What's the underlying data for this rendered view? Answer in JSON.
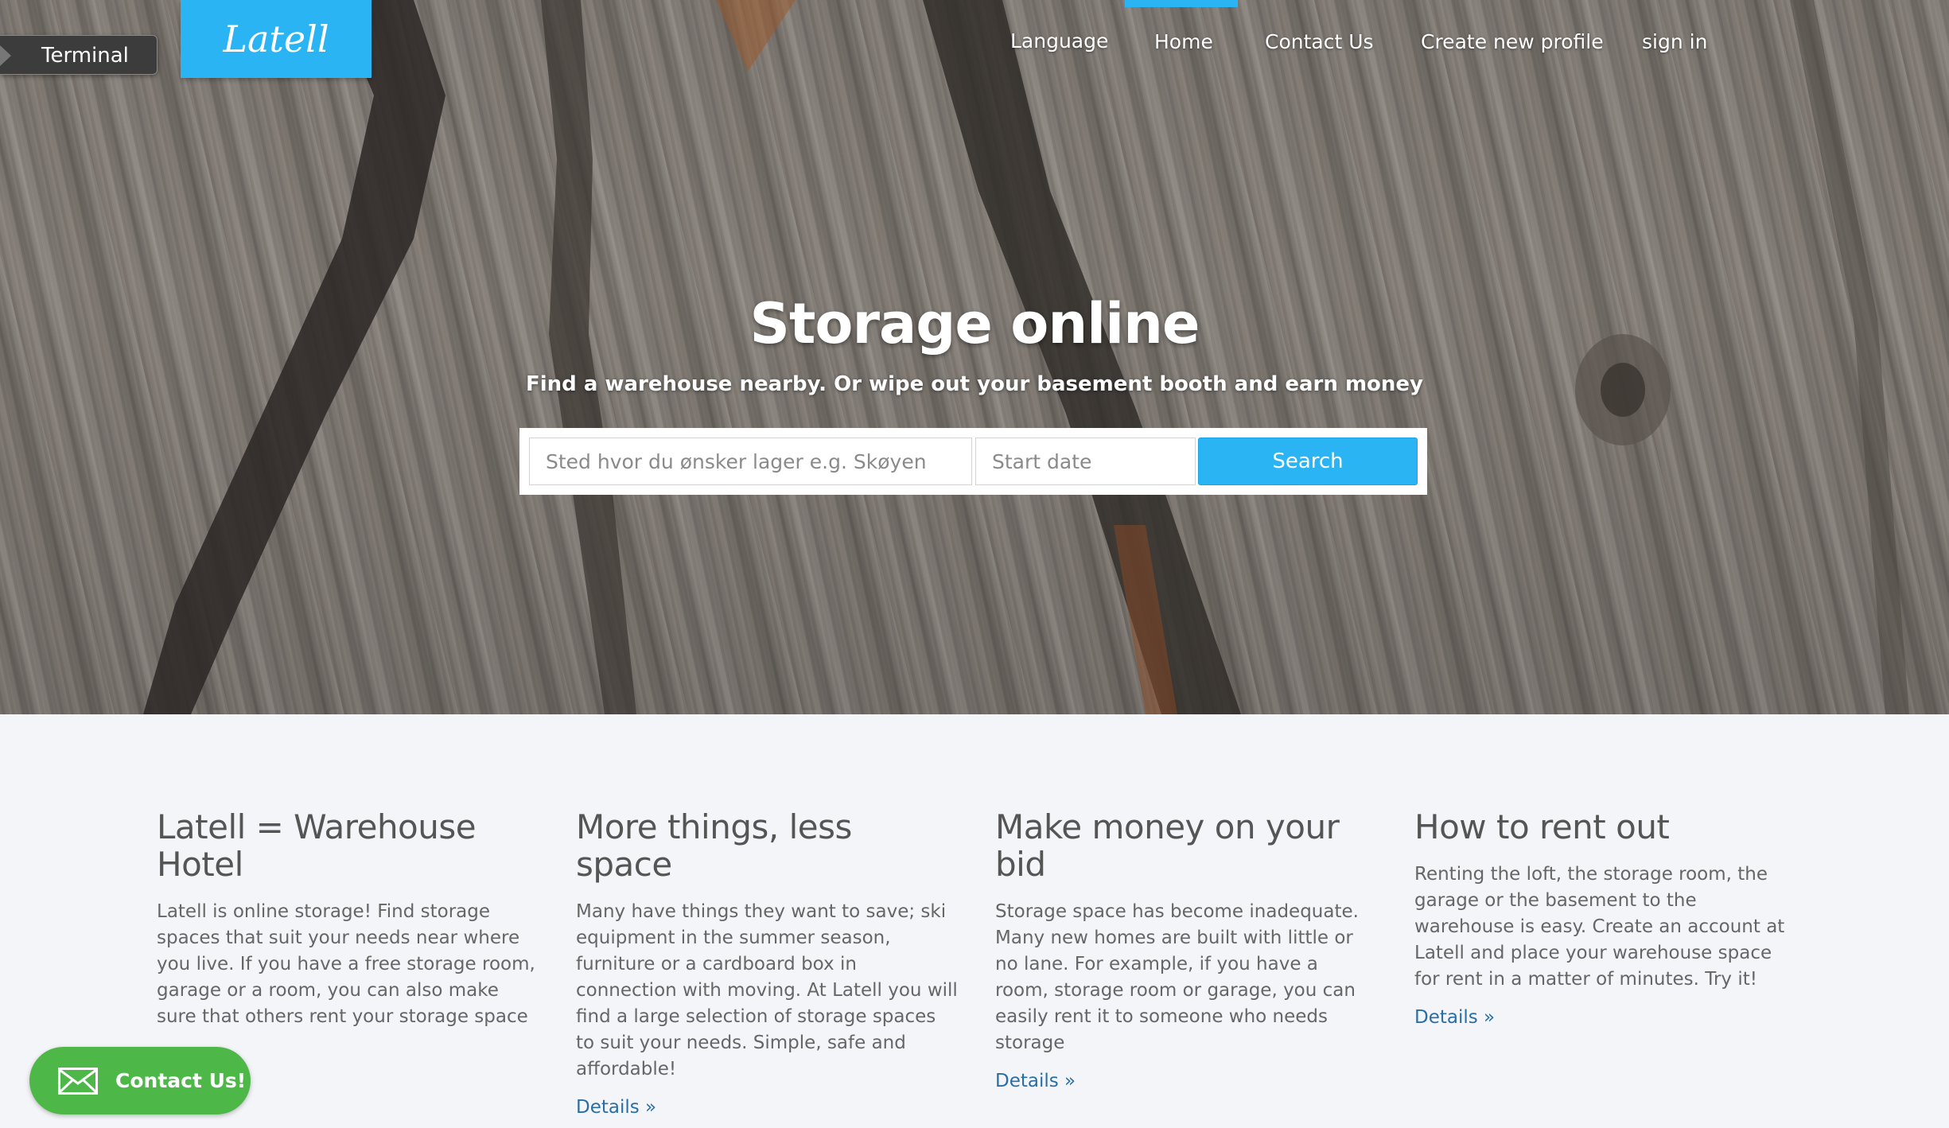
{
  "terminal": {
    "label": "Terminal"
  },
  "logo": {
    "text": "Latell"
  },
  "nav": {
    "items": [
      {
        "label": "Language"
      },
      {
        "label": "Home"
      },
      {
        "label": "Contact Us"
      },
      {
        "label": "Create new profile"
      },
      {
        "label": "sign in"
      }
    ],
    "active": "Home"
  },
  "hero": {
    "title": "Storage online",
    "subtitle": "Find a warehouse nearby. Or wipe out your basement booth and earn money"
  },
  "search": {
    "location_placeholder": "Sted hvor du ønsker lager e.g. Skøyen",
    "date_placeholder": "Start date",
    "button_label": "Search"
  },
  "features": [
    {
      "title": "Latell = Warehouse Hotel",
      "body": "Latell is online storage! Find storage spaces that suit your needs near where you live. If you have a free storage room, garage or a room, you can also make sure that others rent your storage space",
      "link": ""
    },
    {
      "title": "More things, less space",
      "body": "Many have things they want to save; ski equipment in the summer season, furniture or a cardboard box in connection with moving. At Latell you will find a large selection of storage spaces to suit your needs. Simple, safe and affordable!",
      "link": "Details »"
    },
    {
      "title": "Make money on your bid",
      "body": "Storage space has become inadequate. Many new homes are built with little or no lane. For example, if you have a room, storage room or garage, you can easily rent it to someone who needs storage",
      "link": "Details »"
    },
    {
      "title": "How to rent out",
      "body": "Renting the loft, the storage room, the garage or the basement to the warehouse is easy. Create an account at Latell and place your warehouse space for rent in a matter of minutes. Try it!",
      "link": "Details »"
    }
  ],
  "contact_button": {
    "label": "Contact Us!"
  },
  "colors": {
    "accent": "#2ab4f4",
    "link": "#2a6ea6",
    "contact_green": "#4db748",
    "page_bg": "#f4f5f8"
  }
}
